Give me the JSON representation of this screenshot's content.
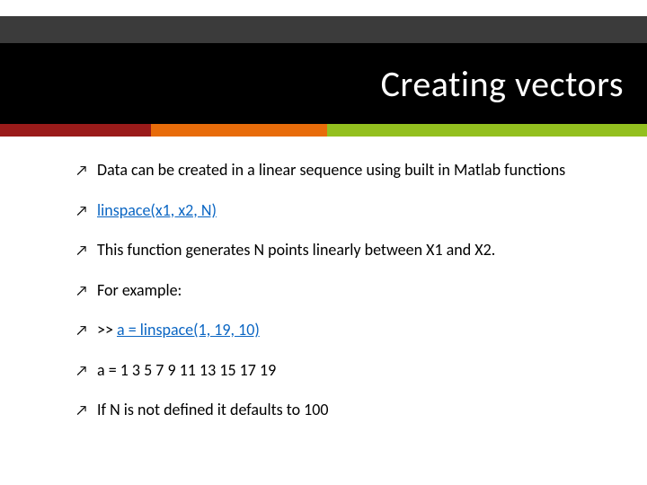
{
  "title": "Creating vectors",
  "bullets": [
    {
      "text": "Data can be created in a linear sequence using built in Matlab functions"
    },
    {
      "text": "linspace(x1, x2, N)",
      "link": true
    },
    {
      "text": "This function generates N points linearly between X1 and X2."
    },
    {
      "text": "For example:"
    },
    {
      "prefix": ">> ",
      "text": "a = linspace(1, 19, 10)",
      "link": true
    },
    {
      "text": "a = 1 3 5 7 9 11 13 15 17 19"
    },
    {
      "text": "If N is not defined it defaults to 100"
    }
  ],
  "arrow_glyph": "↗"
}
